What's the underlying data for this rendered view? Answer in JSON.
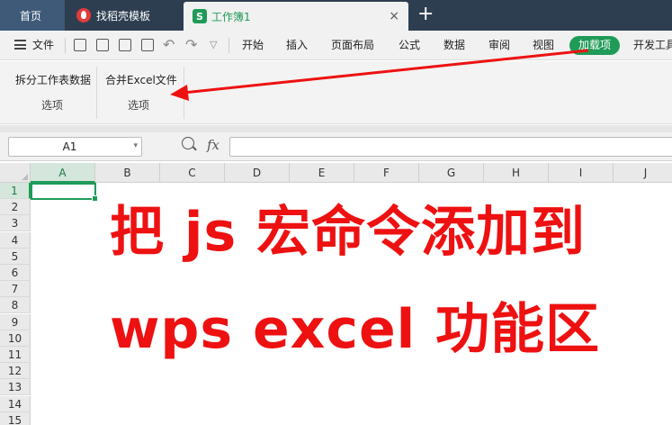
{
  "tabs": {
    "home": "首页",
    "template": "找稻壳模板",
    "workbook": "工作簿1",
    "workbook_badge": "S",
    "close_glyph": "×",
    "new_tab_glyph": "+"
  },
  "menubar": {
    "file": "文件",
    "items": [
      "开始",
      "插入",
      "页面布局",
      "公式",
      "数据",
      "审阅",
      "视图"
    ],
    "addons": "加载项",
    "devtools": "开发工具"
  },
  "ribbon": {
    "split_button": "拆分工作表数据",
    "merge_button": "合并Excel文件",
    "group_label_1": "选项",
    "group_label_2": "选项"
  },
  "formula_bar": {
    "cell_ref": "A1",
    "fx": "fx",
    "content": ""
  },
  "sheet": {
    "columns": [
      "A",
      "B",
      "C",
      "D",
      "E",
      "F",
      "G",
      "H",
      "I",
      "J"
    ],
    "rows": [
      "1",
      "2",
      "3",
      "4",
      "5",
      "6",
      "7",
      "8",
      "9",
      "10",
      "11",
      "12",
      "13",
      "14",
      "15"
    ],
    "active_cell": "A1"
  },
  "overlay": {
    "line1": "把 js 宏命令添加到",
    "line2": "wps excel 功能区"
  },
  "colors": {
    "accent_green": "#1f9b57",
    "overlay_red": "#ee1111",
    "titlebar": "#2d3e50"
  }
}
